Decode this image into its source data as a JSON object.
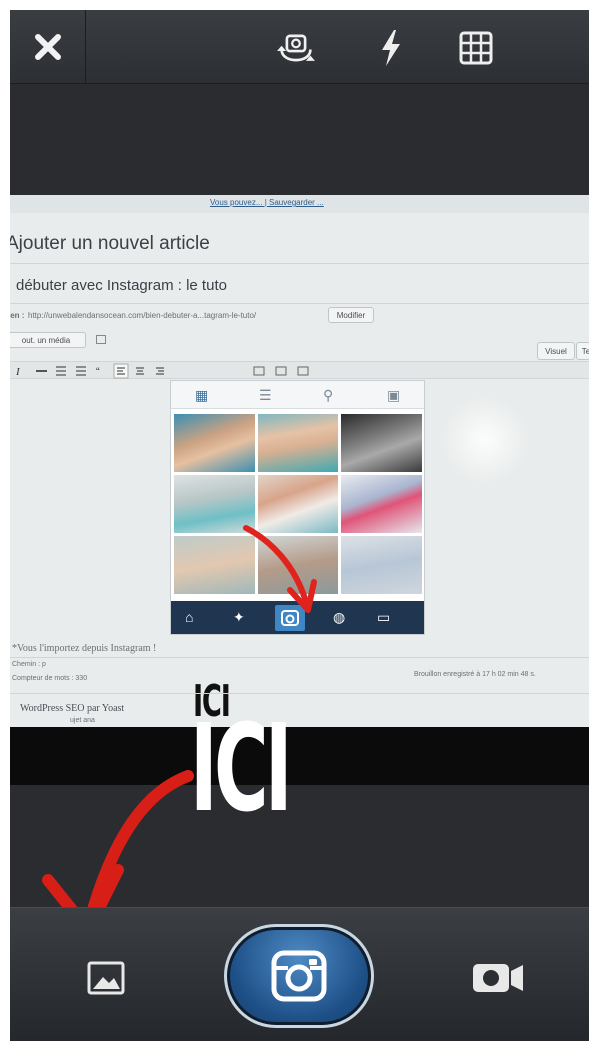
{
  "topbar": {
    "close_icon": "close-icon",
    "flip_camera_icon": "flip-camera-icon",
    "flash_icon": "flash-icon",
    "grid_icon": "grid-icon"
  },
  "viewfinder": {
    "wp_header_link": "Vous pouvez... | Sauvegarder ...",
    "page_heading": "Ajouter un nouvel article",
    "post_title": "débuter avec Instagram : le tuto",
    "permalink_label": "ien :",
    "permalink_url": "http://unwebalendansocean.com/bien-debuter-a...tagram-le-tuto/",
    "modify_button": "Modifier",
    "add_media_button": "out. un média",
    "visual_tab": "Visuel",
    "text_tab": "Te",
    "post_body_line1": "*Vous l'importez depuis Instagram !",
    "post_body_line2": "Chemin : p",
    "word_count": "Compteur de mots : 330",
    "draft_saved": "Brouillon enregistré à 17 h 02 min 48 s.",
    "seo_box_title": "WordPress SEO par Yoast",
    "seo_box_row": "ujet  ana"
  },
  "instagram_screenshot": {
    "top_icons": [
      "grid-icon",
      "list-icon",
      "pin-icon",
      "person-icon"
    ],
    "bottom_icons": [
      "home-icon",
      "explore-icon",
      "camera-icon",
      "activity-icon",
      "profile-icon"
    ],
    "annotation": "ICI"
  },
  "annotation_overlay": {
    "label": "ICI",
    "arrow_color": "#e0231c"
  },
  "bottombar": {
    "gallery_icon": "gallery-icon",
    "shutter_icon": "camera-icon",
    "video_icon": "video-camera-icon"
  }
}
